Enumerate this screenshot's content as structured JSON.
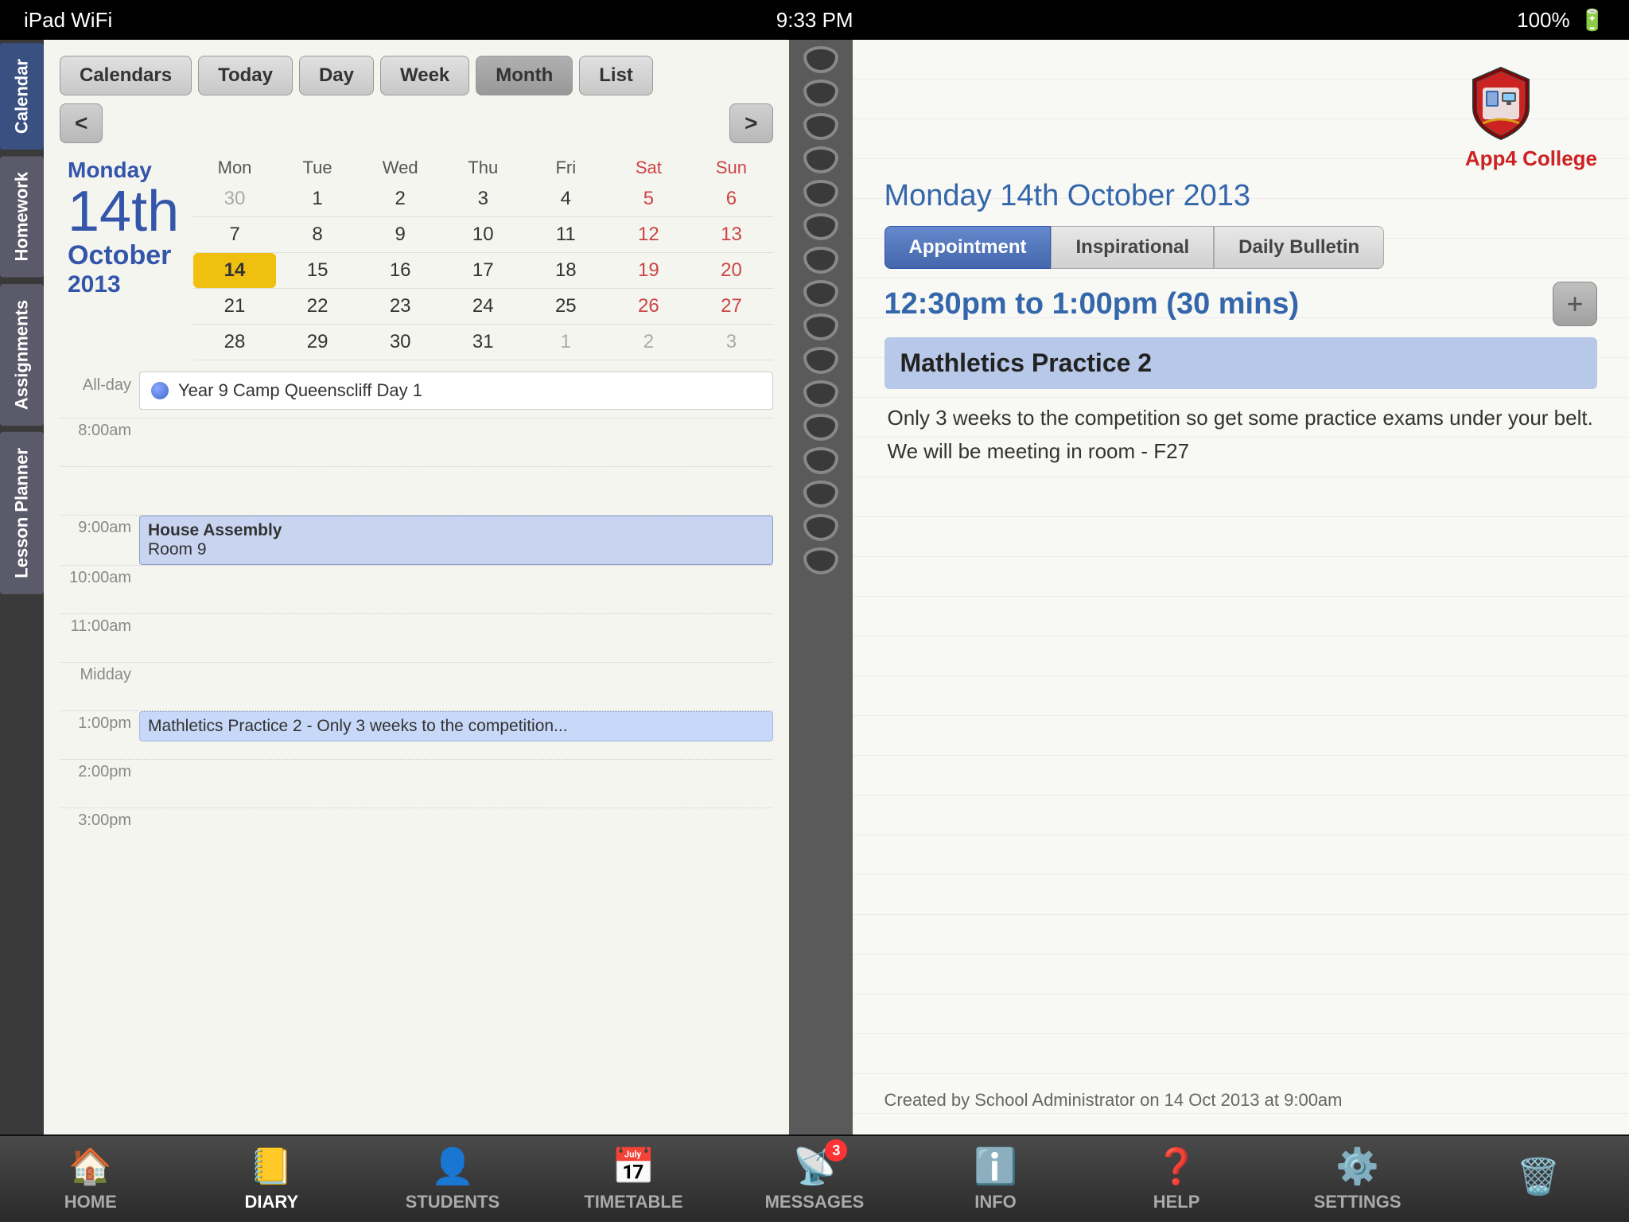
{
  "statusBar": {
    "left": "iPad  WiFi",
    "center": "9:33 PM",
    "right": "100%"
  },
  "sideTabs": [
    {
      "id": "calendar",
      "label": "Calendar",
      "active": true
    },
    {
      "id": "homework",
      "label": "Homework",
      "active": false
    },
    {
      "id": "assignments",
      "label": "Assignments",
      "active": false
    },
    {
      "id": "lessonplanner",
      "label": "Lesson Planner",
      "active": false
    }
  ],
  "calendarToolbar": {
    "calendars": "Calendars",
    "today": "Today",
    "day": "Day",
    "week": "Week",
    "month": "Month",
    "list": "List",
    "prev": "<",
    "next": ">"
  },
  "calendarDate": {
    "dayName": "Monday",
    "dayNum": "14th",
    "monthName": "October",
    "year": "2013"
  },
  "calendarHeaders": [
    "Mon",
    "Tue",
    "Wed",
    "Thu",
    "Fri",
    "Sat",
    "Sun"
  ],
  "calendarWeeks": [
    [
      "30",
      "1",
      "2",
      "3",
      "4",
      "5",
      "6"
    ],
    [
      "7",
      "8",
      "9",
      "10",
      "11",
      "12",
      "13"
    ],
    [
      "14",
      "15",
      "16",
      "17",
      "18",
      "19",
      "20"
    ],
    [
      "21",
      "22",
      "23",
      "24",
      "25",
      "26",
      "27"
    ],
    [
      "28",
      "29",
      "30",
      "31",
      "1",
      "2",
      "3"
    ]
  ],
  "alldayLabel": "All-day",
  "alldayEvent": "Year 9 Camp Queenscliff Day 1",
  "timeSlots": [
    {
      "time": "8:00am",
      "events": []
    },
    {
      "time": "",
      "events": []
    },
    {
      "time": "9:00am",
      "events": [
        {
          "title": "House Assembly",
          "subtitle": "Room 9",
          "style": "blue"
        }
      ]
    },
    {
      "time": "10:00am",
      "events": []
    },
    {
      "time": "11:00am",
      "events": []
    },
    {
      "time": "Midday",
      "events": []
    },
    {
      "time": "1:00pm",
      "events": [
        {
          "title": "Mathletics Practice 2 - Only 3 weeks to the competition...",
          "style": "blue2"
        }
      ]
    },
    {
      "time": "2:00pm",
      "events": []
    },
    {
      "time": "3:00pm",
      "events": []
    }
  ],
  "rightPage": {
    "dateHeader": "Monday 14th October 2013",
    "tabs": [
      {
        "label": "Appointment",
        "active": true
      },
      {
        "label": "Inspirational",
        "active": false
      },
      {
        "label": "Daily Bulletin",
        "active": false
      }
    ],
    "timeRange": "12:30pm to 1:00pm (30 mins)",
    "addBtn": "+",
    "eventTitle": "Mathletics Practice 2",
    "eventDescription": "Only 3 weeks to the competition so get some practice exams under your belt.  We will be meeting in room - F27",
    "footer": "Created by School Administrator on 14 Oct 2013 at 9:00am",
    "logoName": "App4 College"
  },
  "bottomNav": [
    {
      "id": "home",
      "icon": "🏠",
      "label": "HOME",
      "active": false
    },
    {
      "id": "diary",
      "icon": "📓",
      "label": "DIARY",
      "active": true
    },
    {
      "id": "students",
      "icon": "👤",
      "label": "STUDENTS",
      "active": false
    },
    {
      "id": "timetable",
      "icon": "📅",
      "label": "TIMETABLE",
      "active": false
    },
    {
      "id": "messages",
      "icon": "📡",
      "label": "MESSAGES",
      "badge": "3",
      "active": false
    },
    {
      "id": "info",
      "icon": "ℹ️",
      "label": "INFO",
      "active": false
    },
    {
      "id": "help",
      "icon": "❓",
      "label": "HELP",
      "active": false
    },
    {
      "id": "settings",
      "icon": "⚙️",
      "label": "SETTINGS",
      "active": false
    },
    {
      "id": "trash",
      "icon": "🗑️",
      "label": "",
      "active": false
    }
  ]
}
